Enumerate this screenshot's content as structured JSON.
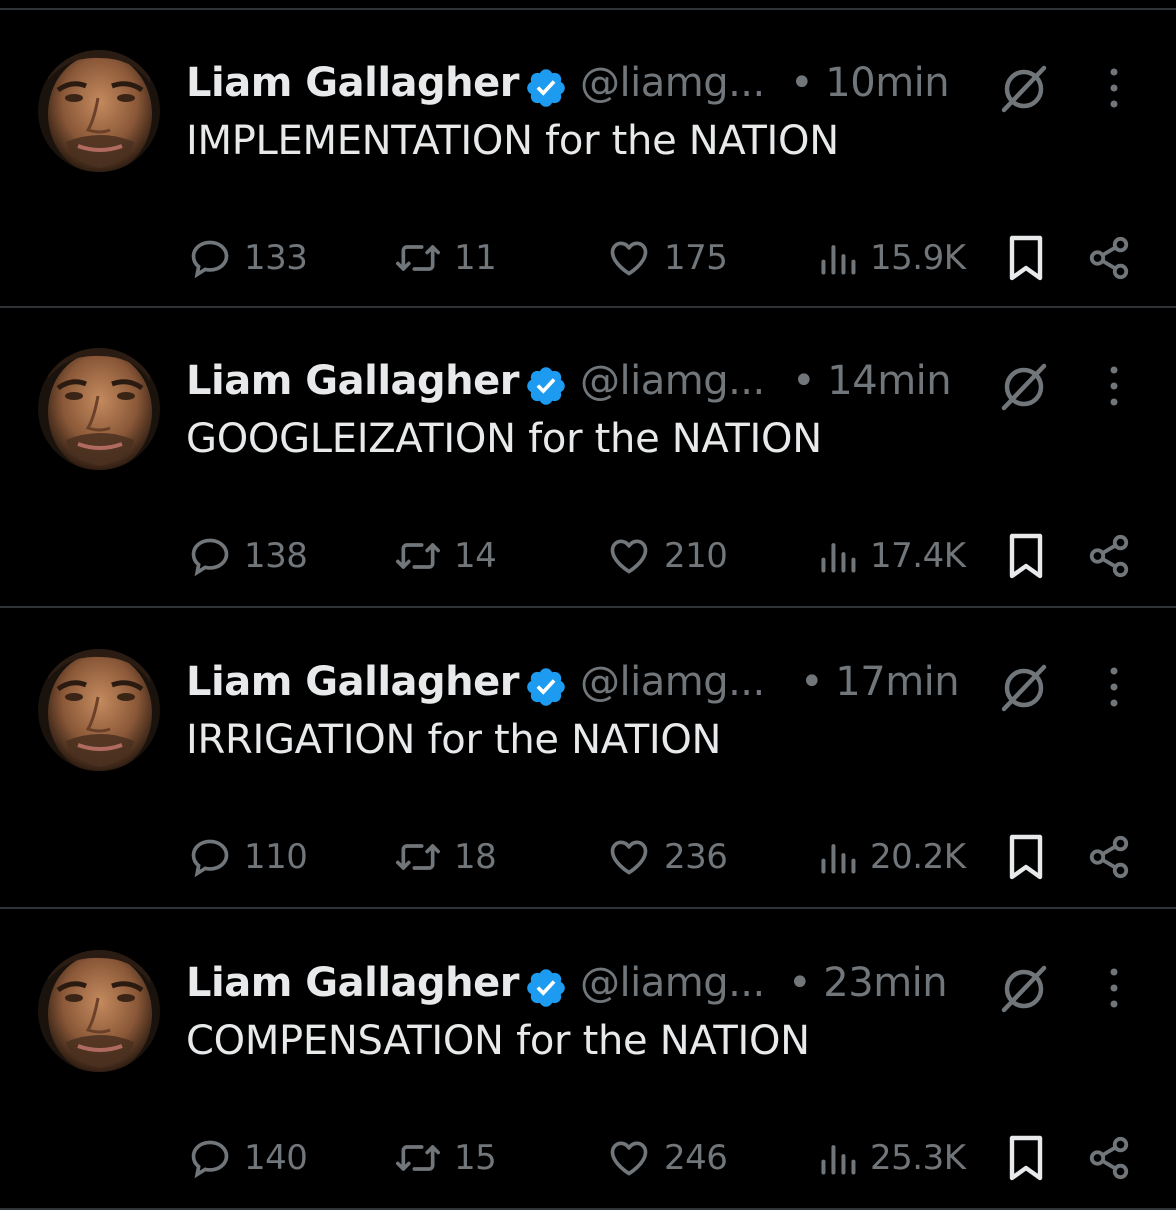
{
  "colors": {
    "background": "#000000",
    "text": "#e7e9ea",
    "muted": "#71767b",
    "verified": "#1d9bf0",
    "divider": "#2f3336"
  },
  "icons": [
    "verified-badge-icon",
    "grok-icon",
    "more-icon",
    "reply-icon",
    "retweet-icon",
    "like-icon",
    "views-icon",
    "bookmark-icon",
    "share-icon"
  ],
  "tweets": [
    {
      "name": "Liam Gallagher",
      "handle": "@liamg...",
      "time": "• 10min",
      "text": "IMPLEMENTATION for the NATION",
      "replies": "133",
      "retweets": "11",
      "likes": "175",
      "views": "15.9K"
    },
    {
      "name": "Liam Gallagher",
      "handle": "@liamg...",
      "time": "• 14min",
      "text": "GOOGLEIZATION for the NATION",
      "replies": "138",
      "retweets": "14",
      "likes": "210",
      "views": "17.4K"
    },
    {
      "name": "Liam Gallagher",
      "handle": "@liamg...",
      "time": "• 17min",
      "text": "IRRIGATION for the NATION",
      "replies": "110",
      "retweets": "18",
      "likes": "236",
      "views": "20.2K"
    },
    {
      "name": "Liam Gallagher",
      "handle": "@liamg...",
      "time": "• 23min",
      "text": "COMPENSATION for the NATION",
      "replies": "140",
      "retweets": "15",
      "likes": "246",
      "views": "25.3K"
    }
  ]
}
